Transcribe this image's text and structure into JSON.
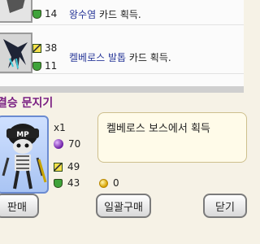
{
  "list": {
    "rows": [
      {
        "attack": "",
        "defense": "14",
        "card_name": "왕수염",
        "card_suffix": "카드 획득."
      },
      {
        "attack": "38",
        "defense": "11",
        "card_name": "켈베로스 발톱",
        "card_suffix": "카드 획득."
      }
    ]
  },
  "panel": {
    "title": "결승 문지기",
    "quantity": "x1",
    "orb_value": "70",
    "attack": "49",
    "defense": "43",
    "coins": "0",
    "description": "켈베로스 보스에서 획득",
    "portrait_badge": "MP"
  },
  "buttons": {
    "sell": "판매",
    "bulk_buy": "일괄구매",
    "close": "닫기"
  },
  "icons": {
    "attack": "sword-icon",
    "defense": "shield-icon",
    "orb": "purple-orb-icon",
    "coin": "gold-coin-icon"
  }
}
